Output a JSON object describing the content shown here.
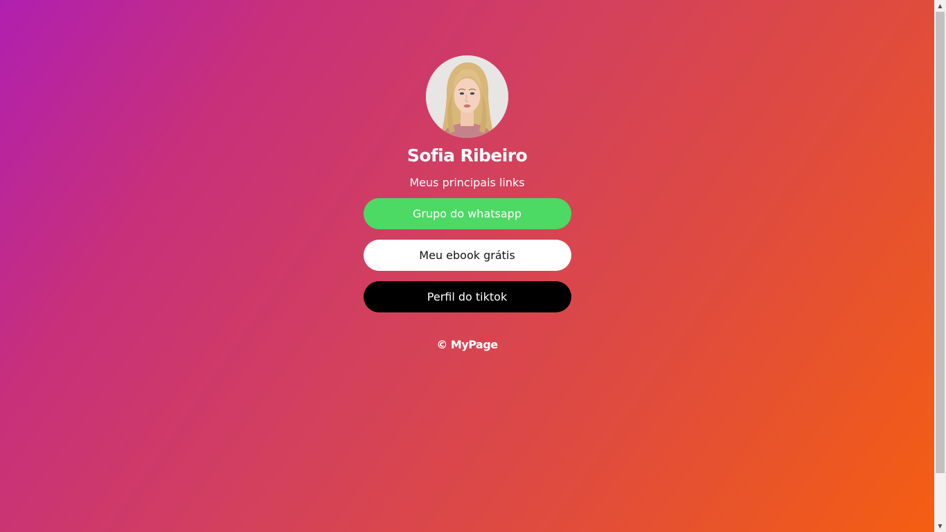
{
  "profile": {
    "name": "Sofia Ribeiro",
    "subtitle": "Meus principais links",
    "avatar_alt": "Sofia Ribeiro"
  },
  "links": [
    {
      "label": "Grupo do whatsapp",
      "color": "#4cd964"
    },
    {
      "label": "Meu ebook grátis",
      "color": "#ffffff"
    },
    {
      "label": "Perfil do tiktok",
      "color": "#000000"
    }
  ],
  "footer": {
    "text": "© MyPage"
  },
  "background": {
    "gradient_start": "#b01fb0",
    "gradient_end": "#f55f10"
  },
  "scrollbar": {
    "up_icon": "chevron-up-icon",
    "down_icon": "chevron-down-icon"
  }
}
